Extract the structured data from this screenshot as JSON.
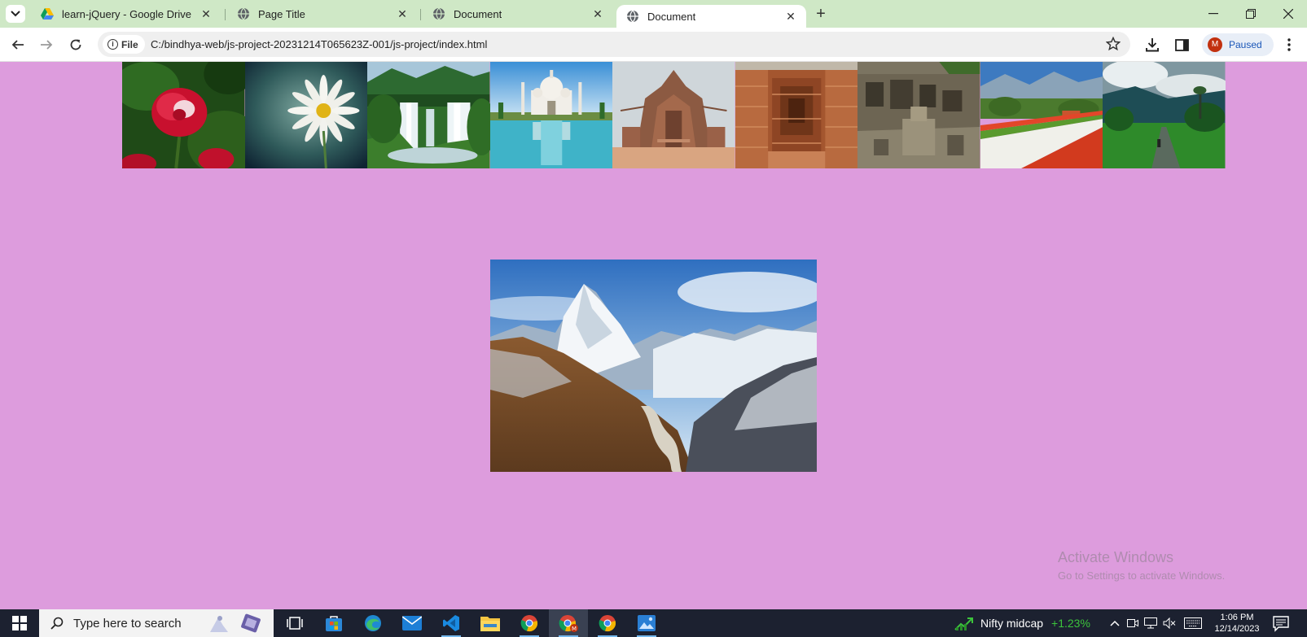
{
  "browser": {
    "tabs": [
      {
        "label": "learn-jQuery - Google Drive",
        "favicon": "google-drive-icon"
      },
      {
        "label": "Page Title",
        "favicon": "globe-icon"
      },
      {
        "label": "Document",
        "favicon": "globe-icon"
      },
      {
        "label": "Document",
        "favicon": "globe-icon",
        "active": true
      }
    ],
    "address": {
      "scheme_chip": "File",
      "url": "C:/bindhya-web/js-project-20231214T065623Z-001/js-project/index.html"
    },
    "profile": {
      "initial": "M",
      "status": "Paused"
    }
  },
  "page": {
    "background": "#dd9cdd",
    "thumbnails": [
      {
        "subject": "red rose"
      },
      {
        "subject": "white daisy"
      },
      {
        "subject": "waterfall"
      },
      {
        "subject": "Taj Mahal"
      },
      {
        "subject": "stone temple"
      },
      {
        "subject": "stepwell"
      },
      {
        "subject": "rock-cut caves"
      },
      {
        "subject": "tulip garden"
      },
      {
        "subject": "green valley road"
      }
    ],
    "hero": {
      "subject": "snowy mountain valley"
    }
  },
  "watermark": {
    "line1": "Activate Windows",
    "line2": "Go to Settings to activate Windows."
  },
  "taskbar": {
    "search_placeholder": "Type here to search",
    "apps": [
      "task-view",
      "microsoft-store",
      "edge",
      "mail",
      "vscode",
      "file-explorer",
      "chrome",
      "chrome-profile",
      "chrome",
      "photos"
    ],
    "widget": {
      "label": "Nifty midcap",
      "change": "+1.23%"
    },
    "clock": {
      "time": "1:06 PM",
      "date": "12/14/2023"
    }
  }
}
